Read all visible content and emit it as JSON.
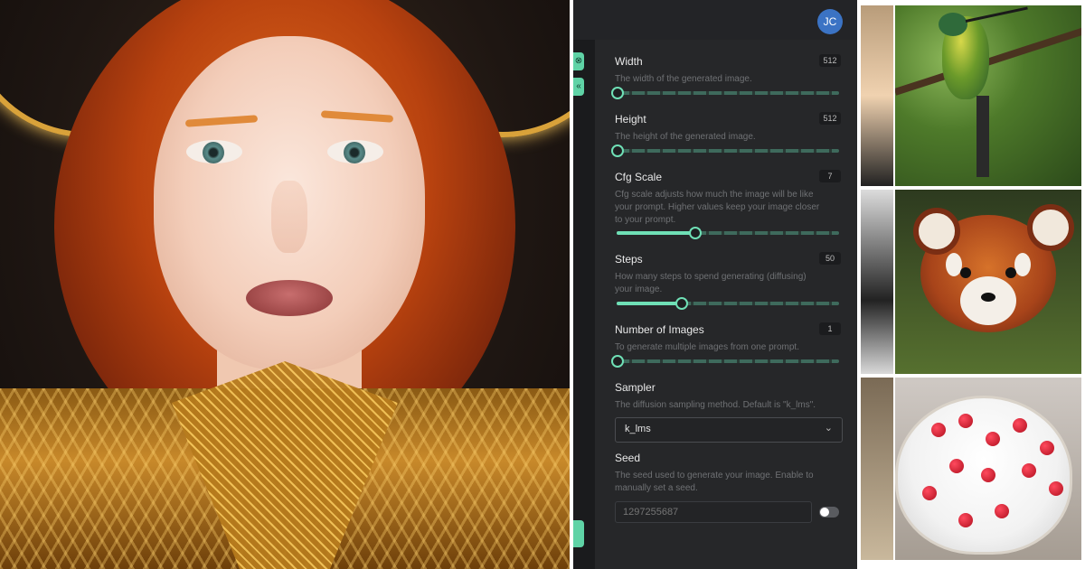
{
  "header": {
    "avatar_initials": "JC"
  },
  "settings": [
    {
      "id": "width",
      "label": "Width",
      "value": "512",
      "description": "The width of the generated image.",
      "fraction": 0.0
    },
    {
      "id": "height",
      "label": "Height",
      "value": "512",
      "description": "The height of the generated image.",
      "fraction": 0.0
    },
    {
      "id": "cfg",
      "label": "Cfg Scale",
      "value": "7",
      "description_lines": [
        "Cfg scale adjusts how much the image will be like",
        "your prompt. Higher values keep your image closer",
        "to your prompt."
      ],
      "fraction": 0.35
    },
    {
      "id": "steps",
      "label": "Steps",
      "value": "50",
      "description_lines": [
        "How many steps to spend generating (diffusing)",
        "your image."
      ],
      "fraction": 0.29
    },
    {
      "id": "num_images",
      "label": "Number of Images",
      "value": "1",
      "description": "To generate multiple images from one prompt.",
      "fraction": 0.0
    }
  ],
  "sampler": {
    "label": "Sampler",
    "description": "The diffusion sampling method. Default is \"k_lms\".",
    "selected": "k_lms"
  },
  "seed": {
    "label": "Seed",
    "description_lines": [
      "The seed used to generate your image. Enable to",
      "manually set a seed."
    ],
    "placeholder": "1297255687",
    "enabled": false
  },
  "colors": {
    "accent": "#6fe0b6",
    "panel_bg": "#262729",
    "avatar_bg": "#3b73c4"
  },
  "icons": {
    "side_top": "close-circle-icon",
    "side_mid": "collapse-icon",
    "chevron": "chevron-down-icon"
  }
}
